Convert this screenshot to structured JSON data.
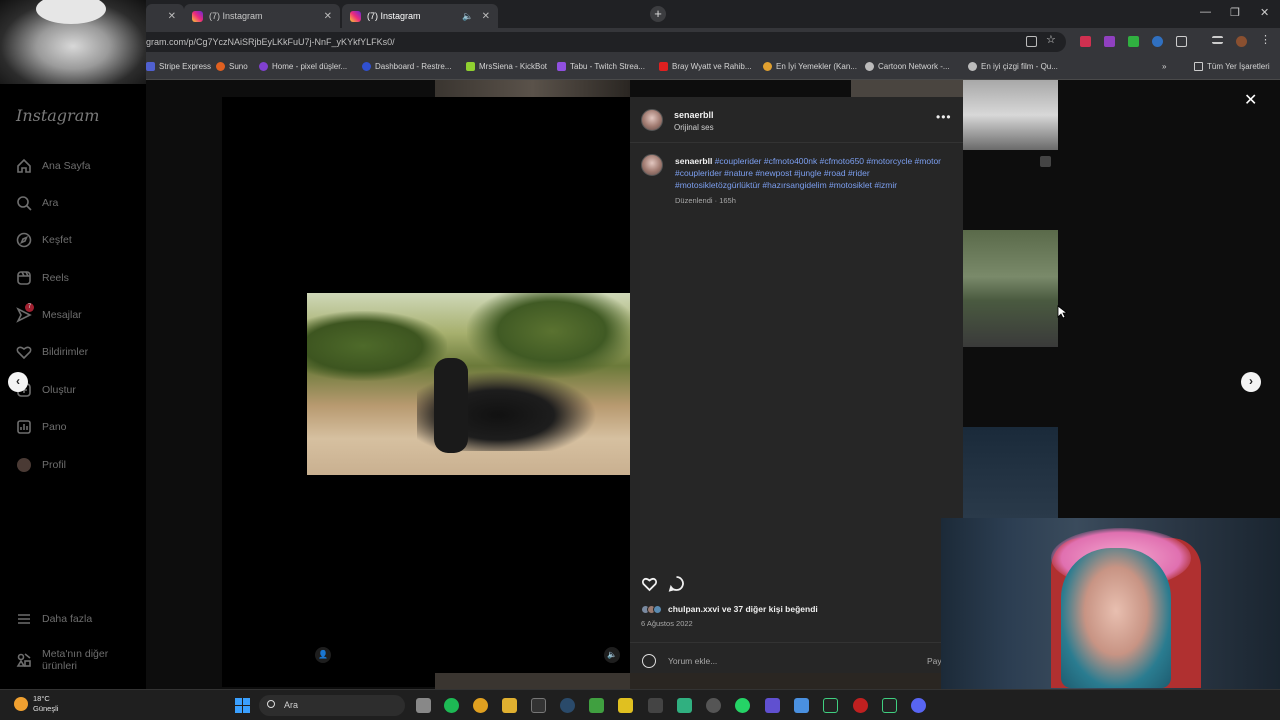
{
  "browser": {
    "tabs": [
      {
        "label": ""
      },
      {
        "label": "(7) Instagram"
      },
      {
        "label": "(7) Instagram"
      }
    ],
    "url": "gram.com/p/Cg7YczNAiSRjbEyLKkFuU7j-NnF_yKYkfYLFKs0/",
    "bookmarks": [
      "Stripe Express",
      "Suno",
      "Home - pixel düşler...",
      "Dashboard - Restre...",
      "MrsSiena - KickBot",
      "Tabu - Twitch Strea...",
      "Bray Wyatt ve Rahib...",
      "En İyi Yemekler (Kan...",
      "Cartoon Network -...",
      "En iyi çizgi film - Qu...",
      "Tüm Yer İşaretleri"
    ]
  },
  "sidebar": {
    "logo": "Instagram",
    "items": [
      {
        "label": "Ana Sayfa",
        "icon": "home-icon"
      },
      {
        "label": "Ara",
        "icon": "search-icon"
      },
      {
        "label": "Keşfet",
        "icon": "compass-icon"
      },
      {
        "label": "Reels",
        "icon": "reels-icon"
      },
      {
        "label": "Mesajlar",
        "icon": "messenger-icon",
        "badge": "7"
      },
      {
        "label": "Bildirimler",
        "icon": "heart-icon"
      },
      {
        "label": "Oluştur",
        "icon": "plus-square-icon"
      },
      {
        "label": "Pano",
        "icon": "chart-icon"
      },
      {
        "label": "Profil",
        "icon": "avatar-icon"
      }
    ],
    "bottom": [
      {
        "label": "Daha fazla",
        "icon": "menu-icon"
      },
      {
        "label": "Meta'nın diğer ürünleri",
        "icon": "meta-apps-icon"
      }
    ]
  },
  "post": {
    "username": "senaerbll",
    "audio": "Orijinal ses",
    "caption_user": "senaerbll",
    "caption_tags": "#couplerider #cfmoto400nk #cfmoto650 #motorcycle #motor #couplerider #nature #newpost #jungle #road #rider #motosikletözgürlüktür #hazırsangidelim #motosiklet #izmir",
    "edited": "Düzenlendi · 165h",
    "liked_by": "chulpan.xxvi ve 37 diğer kişi beğendi",
    "date": "6 Ağustos 2022",
    "comment_placeholder": "Yorum ekle...",
    "post_button": "Pay"
  },
  "taskbar": {
    "temp": "18°C",
    "weather": "Güneşli",
    "search_placeholder": "Ara"
  },
  "colors": {
    "accent_link": "#7c9ff0",
    "panel_bg": "#262626"
  }
}
